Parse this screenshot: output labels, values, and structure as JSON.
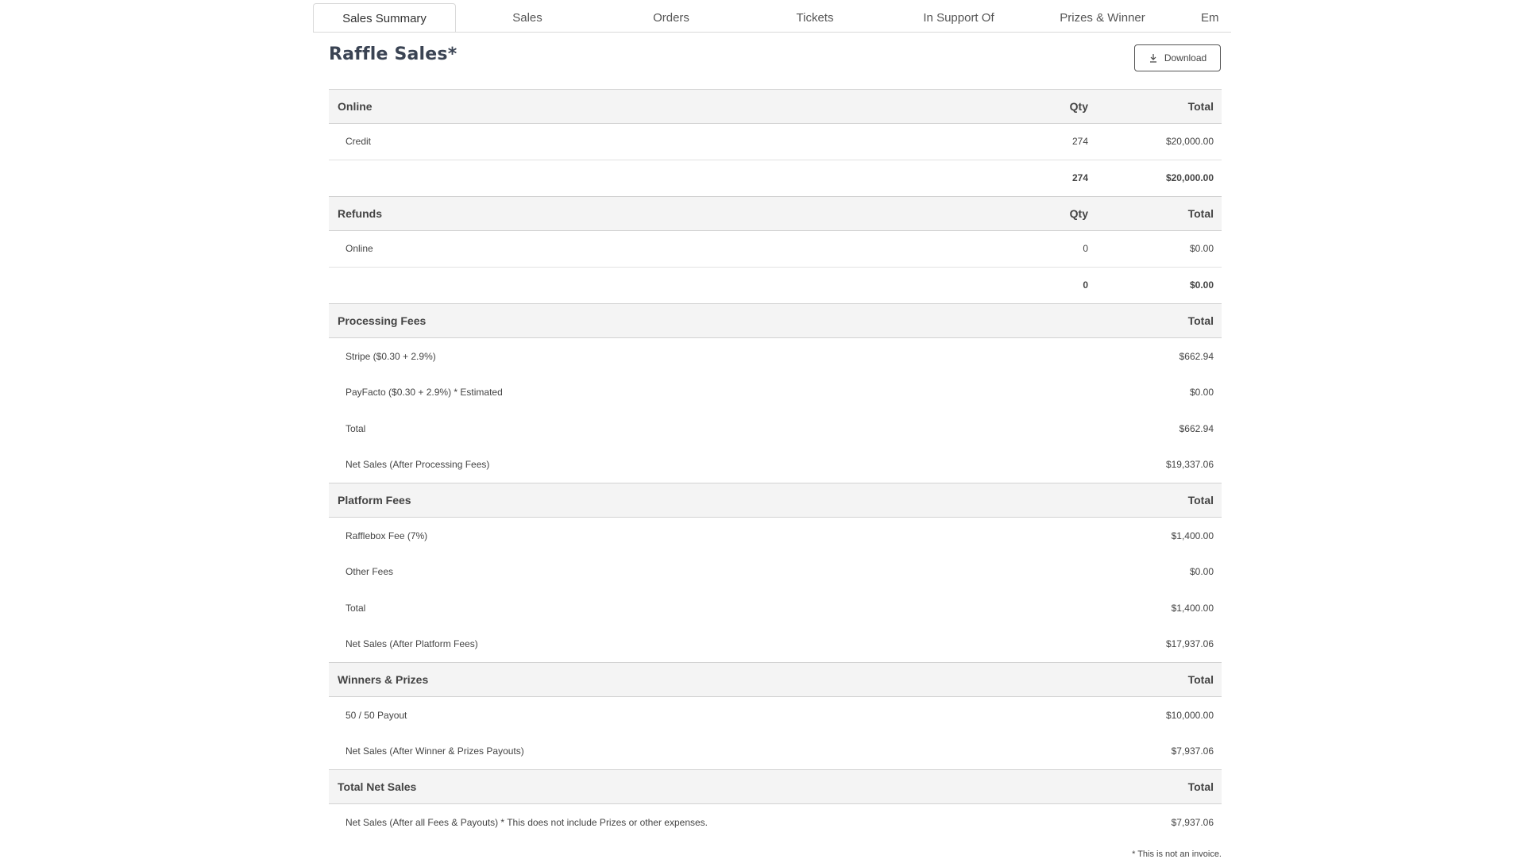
{
  "tabs": [
    {
      "label": "Sales Summary",
      "active": true
    },
    {
      "label": "Sales"
    },
    {
      "label": "Orders"
    },
    {
      "label": "Tickets"
    },
    {
      "label": "In Support Of"
    },
    {
      "label": "Prizes & Winner"
    },
    {
      "label": "Em"
    }
  ],
  "page": {
    "title": "Raffle Sales*",
    "download_label": "Download",
    "download_icon": "download-icon",
    "footnote": "* This is not an invoice."
  },
  "sections": {
    "online": {
      "heading": "Online",
      "qty_header": "Qty",
      "total_header": "Total",
      "rows": [
        {
          "label": "Credit",
          "qty": "274",
          "total": "$20,000.00"
        }
      ],
      "subtotal": {
        "qty": "274",
        "total": "$20,000.00"
      }
    },
    "refunds": {
      "heading": "Refunds",
      "qty_header": "Qty",
      "total_header": "Total",
      "rows": [
        {
          "label": "Online",
          "qty": "0",
          "total": "$0.00"
        }
      ],
      "subtotal": {
        "qty": "0",
        "total": "$0.00"
      }
    },
    "processing": {
      "heading": "Processing Fees",
      "total_header": "Total",
      "rows": [
        {
          "label": "Stripe ($0.30 + 2.9%)",
          "total": "$662.94"
        },
        {
          "label": "PayFacto ($0.30 + 2.9%) * Estimated",
          "total": "$0.00"
        },
        {
          "label": "Total",
          "total": "$662.94"
        },
        {
          "label": "Net Sales (After Processing Fees)",
          "total": "$19,337.06"
        }
      ]
    },
    "platform": {
      "heading": "Platform Fees",
      "total_header": "Total",
      "rows": [
        {
          "label": "Rafflebox Fee (7%)",
          "total": "$1,400.00"
        },
        {
          "label": "Other Fees",
          "total": "$0.00"
        },
        {
          "label": "Total",
          "total": "$1,400.00"
        },
        {
          "label": "Net Sales (After Platform Fees)",
          "total": "$17,937.06"
        }
      ]
    },
    "winners": {
      "heading": "Winners & Prizes",
      "total_header": "Total",
      "rows": [
        {
          "label": "50 / 50 Payout",
          "total": "$10,000.00"
        },
        {
          "label": "Net Sales (After Winner & Prizes Payouts)",
          "total": "$7,937.06"
        }
      ]
    },
    "net": {
      "heading": "Total Net Sales",
      "total_header": "Total",
      "rows": [
        {
          "label": "Net Sales (After all Fees & Payouts) * This does not include Prizes or other expenses.",
          "total": "$7,937.06"
        }
      ]
    }
  }
}
